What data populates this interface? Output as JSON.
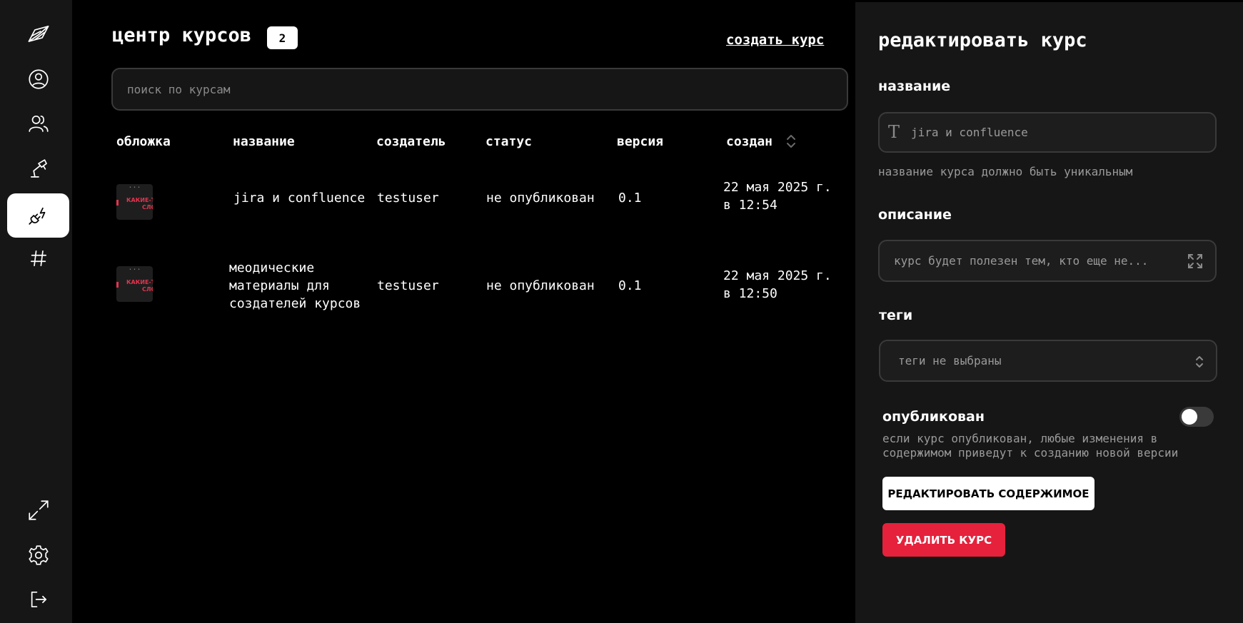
{
  "sidebar": {
    "items": [
      {
        "icon": "logo-icon"
      },
      {
        "icon": "user-profile-icon"
      },
      {
        "icon": "users-icon"
      },
      {
        "icon": "lamp-icon"
      },
      {
        "icon": "plug-icon",
        "active": true
      },
      {
        "icon": "hashtag-icon"
      }
    ],
    "bottom": [
      {
        "icon": "expand-icon"
      },
      {
        "icon": "gear-icon"
      },
      {
        "icon": "logout-icon"
      }
    ]
  },
  "main": {
    "title": "центр курсов",
    "count": "2",
    "create_link": "создать курс",
    "search_placeholder": "поиск по курсам",
    "columns": [
      "обложка",
      "название",
      "создатель",
      "статус",
      "версия",
      "создан"
    ],
    "rows": [
      {
        "cover_text_small": "• • •",
        "cover_text_1": "КАКИЕ-Т",
        "cover_text_2": "СЛО",
        "name": "jira и confluence",
        "creator": "testuser",
        "status": "не опубликован",
        "version": "0.1",
        "created_1": "22 мая 2025 г.",
        "created_2": "в 12:54"
      },
      {
        "cover_text_small": "• • •",
        "cover_text_1": "КАКИЕ-Т",
        "cover_text_2": "СЛО",
        "name_1": "меодические",
        "name_2": "материалы для",
        "name_3": "создателей курсов",
        "creator": "testuser",
        "status": "не опубликован",
        "version": "0.1",
        "created_1": "22 мая 2025 г.",
        "created_2": "в 12:50"
      }
    ]
  },
  "panel": {
    "title": "редактировать курс",
    "name_label": "название",
    "name_value": "jira и confluence",
    "name_hint": "название курса должно быть уникальным",
    "description_label": "описание",
    "description_value": "курс будет полезен тем, кто еще не...",
    "tags_label": "теги",
    "tags_value": "теги не выбраны",
    "published_label": "опубликован",
    "published": false,
    "published_hint_1": "если курс опубликован, любые изменения в",
    "published_hint_2": "содержимом приведут к созданию новой версии",
    "edit_content_button": "РЕДАКТИРОВАТЬ СОДЕРЖИМОЕ",
    "delete_button": "УДАЛИТЬ КУРС"
  },
  "colors": {
    "accent_red": "#e6213c",
    "panel_bg": "#161616",
    "thumb_text": "#e3344e"
  }
}
